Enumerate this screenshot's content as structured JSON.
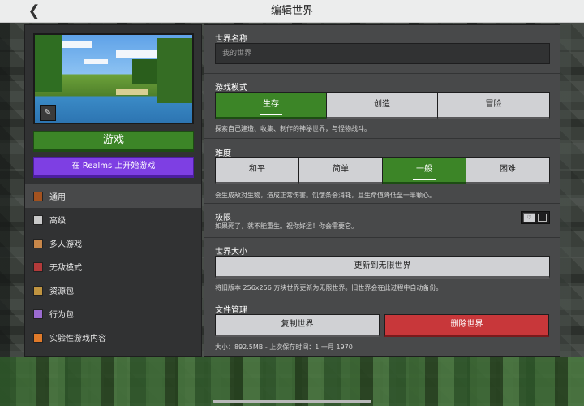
{
  "header": {
    "title": "编辑世界",
    "back_icon": "chevron-left-icon"
  },
  "left": {
    "play_label": "游戏",
    "realms_label": "在 Realms 上开始游戏",
    "nav": [
      {
        "label": "通用",
        "icon": "general-icon",
        "color": "#a3521f",
        "active": true
      },
      {
        "label": "高级",
        "icon": "advanced-icon",
        "color": "#c9c9c9",
        "active": false
      },
      {
        "label": "多人游戏",
        "icon": "multiplayer-icon",
        "color": "#c8874a",
        "active": false
      },
      {
        "label": "无敌模式",
        "icon": "cheats-icon",
        "color": "#b33a3a",
        "active": false
      },
      {
        "label": "资源包",
        "icon": "resource-pack-icon",
        "color": "#c09440",
        "active": false
      },
      {
        "label": "行为包",
        "icon": "behavior-pack-icon",
        "color": "#9b6bd0",
        "active": false
      },
      {
        "label": "实验性游戏内容",
        "icon": "experiments-icon",
        "color": "#e07a2a",
        "active": false
      }
    ]
  },
  "world_name": {
    "title": "世界名称",
    "placeholder": "我的世界"
  },
  "game_mode": {
    "title": "游戏模式",
    "options": [
      "生存",
      "创造",
      "冒险"
    ],
    "selected": "生存",
    "description": "探索自己建造、收集、制作的神秘世界，与怪物战斗。"
  },
  "difficulty": {
    "title": "难度",
    "options": [
      "和平",
      "简单",
      "一般",
      "困难"
    ],
    "selected": "一般",
    "description": "会生成敌对生物，造成正常伤害。饥饿条会消耗，且生命值降低至一半颗心。"
  },
  "hardcore": {
    "title": "极限",
    "description": "如果死了，就不能重生。祝你好运！你会需要它。",
    "enabled": false
  },
  "world_size": {
    "title": "世界大小",
    "button_label": "更新到无限世界",
    "description": "将旧版本 256x256 方块世界更新为无限世界。旧世界会在此过程中自动备份。"
  },
  "file_management": {
    "title": "文件管理",
    "copy_label": "复制世界",
    "delete_label": "删除世界",
    "info": "大小：892.5MB - 上次保存时间：1 一月 1970"
  }
}
